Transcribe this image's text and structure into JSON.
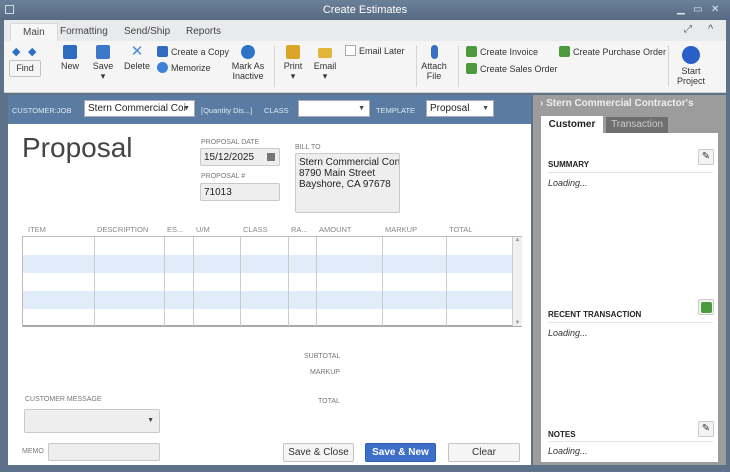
{
  "window": {
    "title": "Create Estimates"
  },
  "ribbon_tabs": [
    "Main",
    "Formatting",
    "Send/Ship",
    "Reports"
  ],
  "toolbar": {
    "find": "Find",
    "new": "New",
    "save": "Save",
    "delete": "Delete",
    "create_copy": "Create a Copy",
    "memorize": "Memorize",
    "mark_inactive_1": "Mark As",
    "mark_inactive_2": "Inactive",
    "print": "Print",
    "email": "Email",
    "email_later": "Email Later",
    "attach_1": "Attach",
    "attach_2": "File",
    "create_invoice": "Create Invoice",
    "create_sales_order": "Create Sales Order",
    "create_po": "Create Purchase Order",
    "start_project_1": "Start",
    "start_project_2": "Project"
  },
  "customer_bar": {
    "customer_job_label": "CUSTOMER:JOB",
    "customer_job_value": "Stern Commercial Coi",
    "quantity_disc": "[Quantity Dis...]",
    "class_label": "CLASS",
    "class_value": "",
    "template_label": "TEMPLATE",
    "template_value": "Proposal"
  },
  "form": {
    "title": "Proposal",
    "date_label": "PROPOSAL DATE",
    "date_value": "15/12/2025",
    "number_label": "PROPOSAL #",
    "number_value": "71013",
    "bill_to_label": "BILL TO",
    "bill_to_lines": [
      "Stern Commercial Contr",
      "8790 Main Street",
      "Bayshore, CA 97678"
    ]
  },
  "table": {
    "columns": [
      "ITEM",
      "DESCRIPTION",
      "ES...",
      "U/M",
      "CLASS",
      "RA...",
      "AMOUNT",
      "MARKUP",
      "TOTAL"
    ]
  },
  "totals": {
    "subtotal": "SUBTOTAL",
    "markup": "MARKUP",
    "total": "TOTAL"
  },
  "footer": {
    "customer_message_label": "CUSTOMER MESSAGE",
    "memo_label": "MEMO",
    "save_close": "Save & Close",
    "save_new": "Save & New",
    "clear": "Clear"
  },
  "panel": {
    "header": "Stern Commercial Contractor's",
    "tabs": [
      "Customer",
      "Transaction"
    ],
    "summary": "SUMMARY",
    "summary_text": "Loading...",
    "recent": "RECENT TRANSACTION",
    "recent_text": "Loading...",
    "notes": "NOTES",
    "notes_text": "Loading..."
  },
  "colors": {
    "accent": "#3d6fc9",
    "customer_bar": "#5a7ca3",
    "row_stripe": "#e1ecfa"
  }
}
